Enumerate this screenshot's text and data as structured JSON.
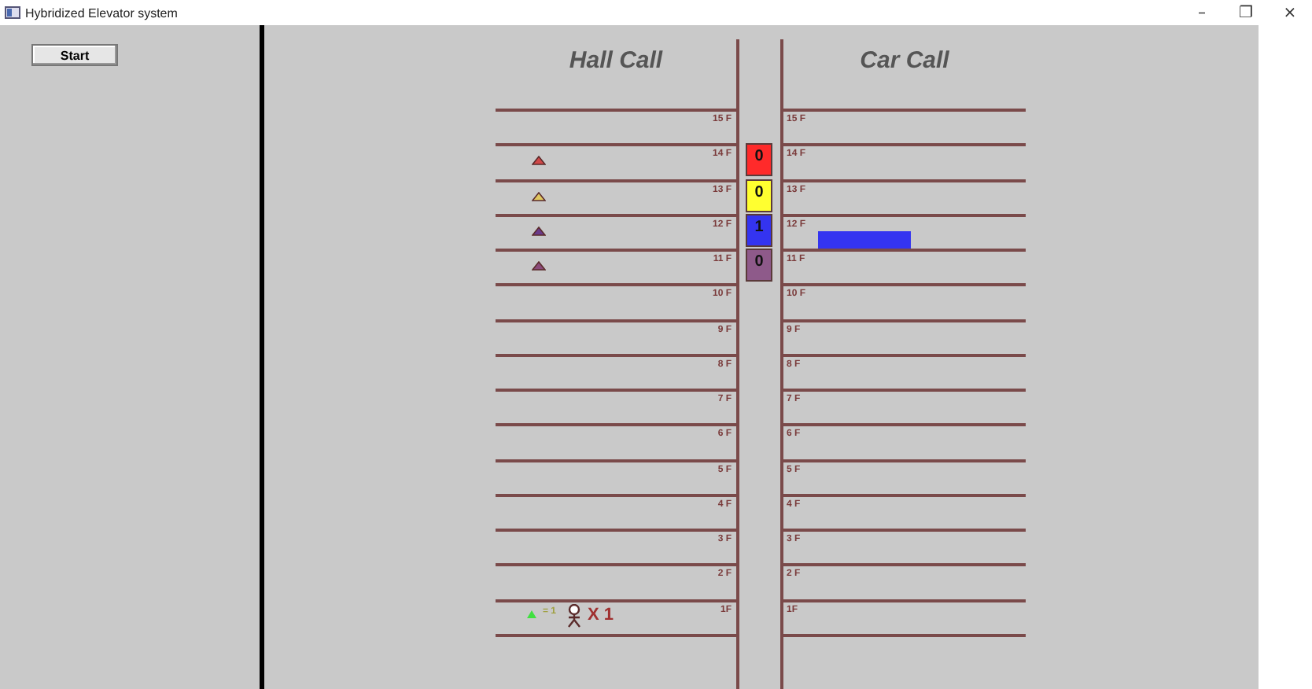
{
  "window": {
    "title": "Hybridized Elevator system",
    "controls": [
      "–",
      "❐",
      "×"
    ]
  },
  "start_button": "Start",
  "hall_header": "Hall Call",
  "car_header": "Car Call",
  "floors": [
    {
      "hall_label": "15 F",
      "car_label": "15 F"
    },
    {
      "hall_label": "14 F",
      "car_label": "14 F",
      "hall_call": {
        "color": "#d04848"
      },
      "car": {
        "count": "0",
        "color": "#ff2a2a"
      }
    },
    {
      "hall_label": "13 F",
      "car_label": "13 F",
      "hall_call": {
        "color": "#e0c860"
      },
      "car": {
        "count": "0",
        "color": "#ffff30"
      }
    },
    {
      "hall_label": "12 F",
      "car_label": "12 F",
      "hall_call": {
        "color": "#6a3a8a"
      },
      "car": {
        "count": "1",
        "color": "#3434f0"
      },
      "car_call": {
        "color": "#3434f0"
      }
    },
    {
      "hall_label": "11 F",
      "car_label": "11 F",
      "hall_call": {
        "color": "#8a4a7a"
      },
      "car": {
        "count": "0",
        "color": "#8e5a8a"
      }
    },
    {
      "hall_label": "10 F",
      "car_label": "10 F"
    },
    {
      "hall_label": "9 F",
      "car_label": "9 F"
    },
    {
      "hall_label": "8 F",
      "car_label": "8 F"
    },
    {
      "hall_label": "7 F",
      "car_label": "7 F"
    },
    {
      "hall_label": "6 F",
      "car_label": "6 F"
    },
    {
      "hall_label": "5 F",
      "car_label": "5 F"
    },
    {
      "hall_label": "4 F",
      "car_label": "4 F"
    },
    {
      "hall_label": "3 F",
      "car_label": "3 F"
    },
    {
      "hall_label": "2 F",
      "car_label": "2 F"
    },
    {
      "hall_label": "1F",
      "car_label": "1F",
      "waiting": {
        "sign": "= 1",
        "count": "X 1"
      }
    }
  ]
}
